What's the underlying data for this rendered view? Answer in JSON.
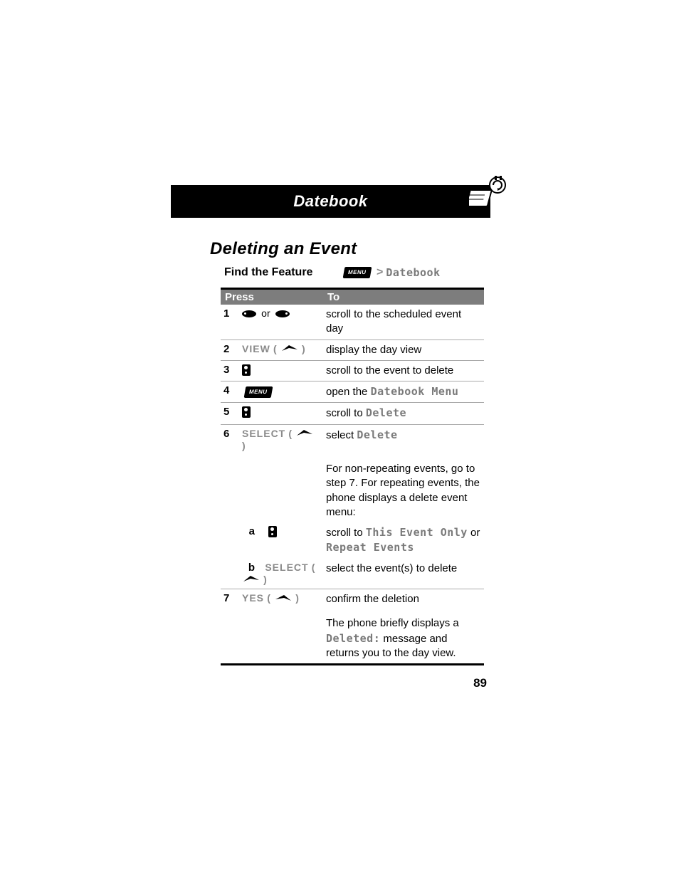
{
  "header": {
    "title": "Datebook"
  },
  "section_title": "Deleting an Event",
  "find_feature": {
    "label": "Find the Feature",
    "menu_key": "MENU",
    "gt": ">",
    "target": "Datebook"
  },
  "table": {
    "head_press": "Press",
    "head_to": "To",
    "rows": [
      {
        "n": "1",
        "press_kind": "ovals",
        "or": "or",
        "to_plain": "scroll to the scheduled event day"
      },
      {
        "n": "2",
        "press_kind": "softkey",
        "press_label": "VIEW",
        "arrow": "right",
        "to_plain": "display the day view"
      },
      {
        "n": "3",
        "press_kind": "scroll",
        "to_plain": "scroll to the event to delete"
      },
      {
        "n": "4",
        "press_kind": "menu",
        "menu_label": "MENU",
        "to_pre": "open the ",
        "to_mono": "Datebook Menu"
      },
      {
        "n": "5",
        "press_kind": "scroll",
        "to_pre": "scroll to ",
        "to_mono": "Delete"
      },
      {
        "n": "6",
        "press_kind": "softkey",
        "press_label": "SELECT",
        "arrow": "right",
        "to_pre": "select ",
        "to_mono": "Delete"
      },
      {
        "note": "For non-repeating events, go to step 7. For repeating events, the phone displays a delete event menu:"
      },
      {
        "sub": "a",
        "press_kind": "scroll",
        "to_pre": "scroll to ",
        "to_mono": "This Event Only",
        "to_mid": " or ",
        "to_mono2": "Repeat Events"
      },
      {
        "sub": "b",
        "press_kind": "softkey",
        "press_label": "SELECT",
        "arrow": "right",
        "to_plain": "select the event(s) to delete"
      },
      {
        "n": "7",
        "press_kind": "softkey",
        "press_label": "YES",
        "arrow": "left",
        "to_plain": "confirm the deletion"
      },
      {
        "note_pre": "The phone briefly displays a ",
        "note_mono": "Deleted:",
        "note_post": " message and returns you to the day view."
      }
    ]
  },
  "page_number": "89"
}
